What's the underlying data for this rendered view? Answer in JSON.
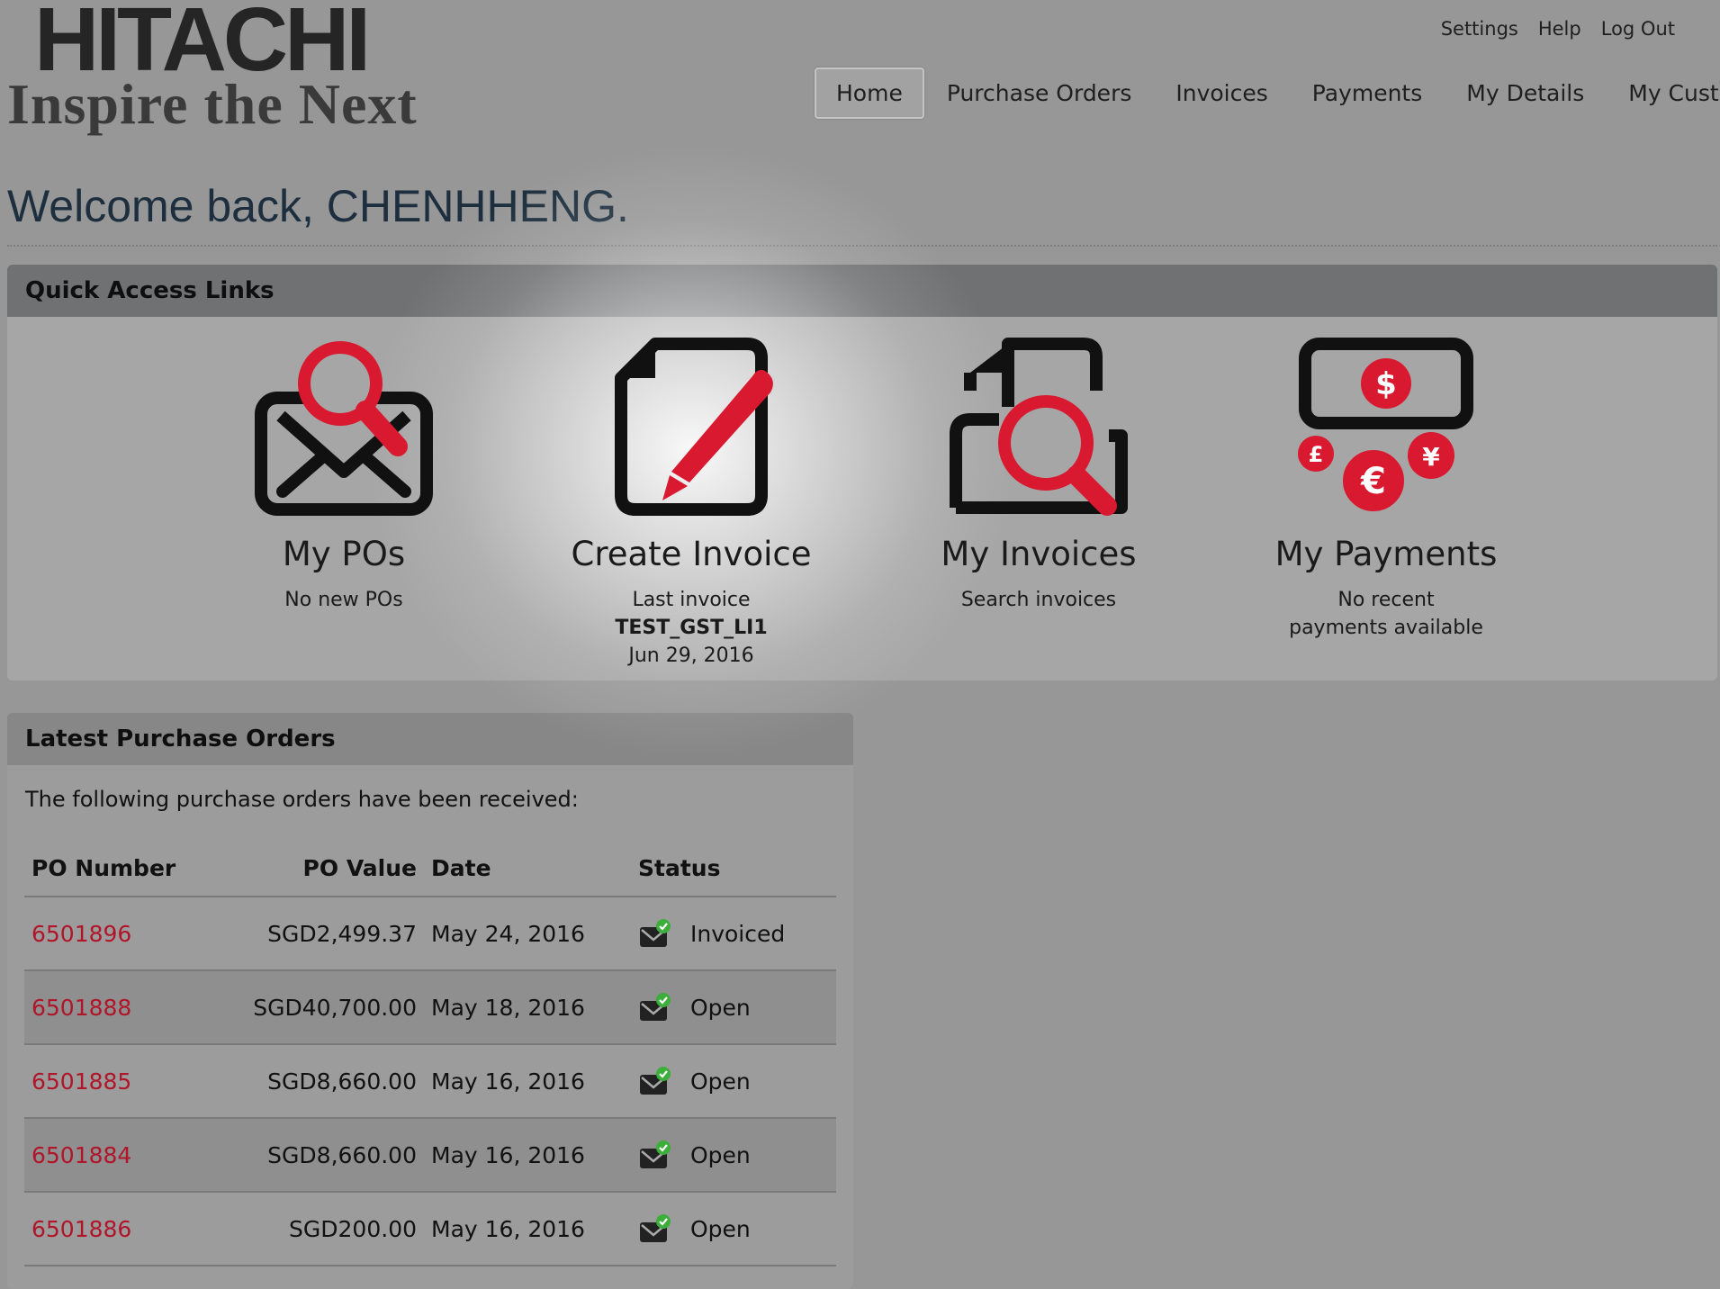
{
  "brand": {
    "name": "HITACHI",
    "tagline": "Inspire the Next"
  },
  "util_links": [
    "Settings",
    "Help",
    "Log Out"
  ],
  "nav": {
    "items": [
      "Home",
      "Purchase Orders",
      "Invoices",
      "Payments",
      "My Details",
      "My Customer"
    ],
    "active": "Home"
  },
  "welcome": "Welcome back, CHENHHENG.",
  "quick_access": {
    "title": "Quick Access Links",
    "items": [
      {
        "icon": "po-envelope-search-icon",
        "title": "My POs",
        "lines": [
          "No new POs"
        ]
      },
      {
        "icon": "document-pencil-icon",
        "title": "Create Invoice",
        "lines": [
          "Last invoice",
          "TEST_GST_LI1",
          "Jun 29, 2016"
        ]
      },
      {
        "icon": "document-search-icon",
        "title": "My Invoices",
        "lines": [
          "Search invoices"
        ]
      },
      {
        "icon": "currency-money-icon",
        "title": "My Payments",
        "lines": [
          "No recent",
          "payments available"
        ]
      }
    ]
  },
  "latest_pos": {
    "title": "Latest Purchase Orders",
    "intro": "The following purchase orders have been received:",
    "columns": [
      "PO Number",
      "PO Value",
      "Date",
      "Status"
    ],
    "rows": [
      {
        "po": "6501896",
        "value": "SGD2,499.37",
        "date": "May 24, 2016",
        "status": "Invoiced"
      },
      {
        "po": "6501888",
        "value": "SGD40,700.00",
        "date": "May 18, 2016",
        "status": "Open"
      },
      {
        "po": "6501885",
        "value": "SGD8,660.00",
        "date": "May 16, 2016",
        "status": "Open"
      },
      {
        "po": "6501884",
        "value": "SGD8,660.00",
        "date": "May 16, 2016",
        "status": "Open"
      },
      {
        "po": "6501886",
        "value": "SGD200.00",
        "date": "May 16, 2016",
        "status": "Open"
      }
    ]
  },
  "colors": {
    "accent_red": "#d8192f",
    "link_red": "#b0152a",
    "status_green": "#3cae3a"
  }
}
